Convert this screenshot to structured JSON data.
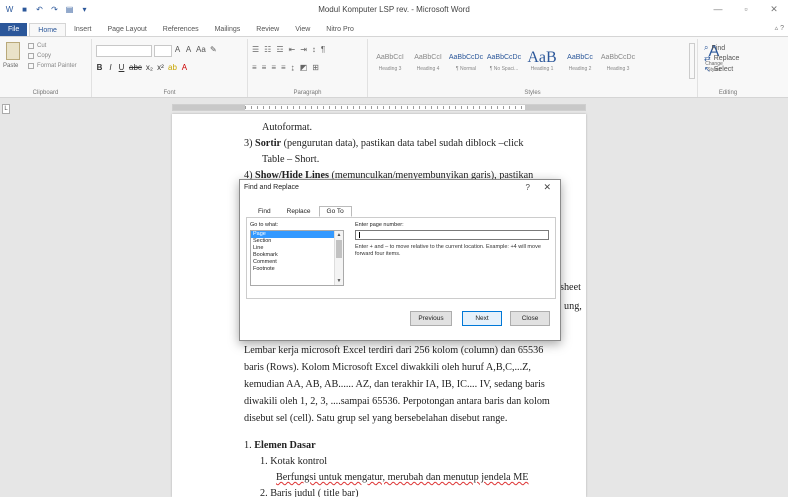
{
  "window": {
    "title": "Modul Komputer LSP rev. - Microsoft Word",
    "controls": {
      "minimize": "—",
      "maximize": "▫",
      "close": "✕"
    }
  },
  "ribbon_tabs": [
    {
      "label": "File"
    },
    {
      "label": "Home"
    },
    {
      "label": "Insert"
    },
    {
      "label": "Page Layout"
    },
    {
      "label": "References"
    },
    {
      "label": "Mailings"
    },
    {
      "label": "Review"
    },
    {
      "label": "View"
    },
    {
      "label": "Nitro Pro"
    }
  ],
  "ribbon": {
    "clipboard": {
      "label": "Clipboard",
      "paste": "Paste",
      "cut": "Cut",
      "copy": "Copy",
      "format_painter": "Format Painter"
    },
    "font": {
      "label": "Font",
      "grow": "A",
      "shrink": "A",
      "case": "Aa",
      "bold": "B",
      "italic": "I",
      "underline": "U",
      "strike": "abc",
      "subscript": "x₂",
      "superscript": "x²",
      "highlight": "ab",
      "color": "A"
    },
    "paragraph": {
      "label": "Paragraph"
    },
    "styles": {
      "label": "Styles",
      "tiles": [
        {
          "sample": "AaBbCcI",
          "name": "Heading 3"
        },
        {
          "sample": "AaBbCcI",
          "name": "Heading 4"
        },
        {
          "sample": "AaBbCcDc",
          "name": "¶ Normal"
        },
        {
          "sample": "AaBbCcDc",
          "name": "¶ No Spaci..."
        },
        {
          "sample": "AaB",
          "name": "Heading 1"
        },
        {
          "sample": "AaBbCc",
          "name": "Heading 2"
        },
        {
          "sample": "AaBbCcDc",
          "name": "Heading 3"
        }
      ],
      "change_styles": "Change Styles"
    },
    "editing": {
      "label": "Editing",
      "find": "Find",
      "replace": "Replace",
      "select": "Select"
    }
  },
  "document": {
    "lines": [
      {
        "segments": [
          {
            "text": "Autoformat."
          }
        ]
      },
      {
        "segments": [
          {
            "text": "3)  "
          },
          {
            "text": "Sortir",
            "style": "bold"
          },
          {
            "text": " (pengurutan data), pastikan data tabel sudah diblock –click"
          }
        ]
      },
      {
        "segments": [
          {
            "text": "Table – Short."
          }
        ]
      },
      {
        "segments": [
          {
            "text": "4)  "
          },
          {
            "text": "Show/Hide Lines",
            "style": "bold"
          },
          {
            "text": " (memunculkan/menyembunyikan garis), pastikan"
          }
        ]
      },
      {
        "segments": [
          {
            "text": "sheet"
          }
        ]
      },
      {
        "segments": [
          {
            "text": "ung,"
          }
        ]
      },
      {
        "segments": [
          {
            "text": "Lembar kerja microsoft Excel terdiri dari 256 kolom (column) dan 65536"
          }
        ]
      },
      {
        "segments": [
          {
            "text": "baris (Rows). Kolom Microsoft Excel diwakkili oleh huruf A,B,C,...Z,"
          }
        ]
      },
      {
        "segments": [
          {
            "text": "kemudian AA, AB, AB...... AZ, dan terakhir IA, IB, IC.... IV, sedang baris"
          }
        ]
      },
      {
        "segments": [
          {
            "text": "diwakili oleh 1, 2, 3, ....sampai 65536. Perpotongan antara baris dan kolom"
          }
        ]
      },
      {
        "segments": [
          {
            "text": "disebut sel (cell). Satu grup sel yang bersebelahan disebut range."
          }
        ]
      },
      {
        "segments": [
          {
            "text": "1.  "
          },
          {
            "text": "Elemen Dasar",
            "style": "bold"
          }
        ]
      },
      {
        "segments": [
          {
            "text": "1.  Kotak kontrol"
          }
        ]
      },
      {
        "segments": [
          {
            "text": "Berfungsi untuk mengatur, merubah dan menutup jendela ME",
            "style": "squig"
          }
        ]
      },
      {
        "segments": [
          {
            "text": "2.  Baris judul ( title bar)"
          }
        ]
      }
    ]
  },
  "dialog": {
    "title": "Find and Replace",
    "help": "?",
    "close": "✕",
    "tabs": [
      {
        "label": "Find"
      },
      {
        "label": "Replace"
      },
      {
        "label": "Go To",
        "active": true
      }
    ],
    "goto_label": "Go to what:",
    "goto_items": [
      "Page",
      "Section",
      "Line",
      "Bookmark",
      "Comment",
      "Footnote"
    ],
    "selected_item": "Page",
    "enter_label": "Enter page number:",
    "page_number_value": "",
    "hint": "Enter + and – to move relative to the current location. Example: +4 will move forward four items.",
    "buttons": {
      "previous": "Previous",
      "next": "Next",
      "close": "Close"
    }
  }
}
